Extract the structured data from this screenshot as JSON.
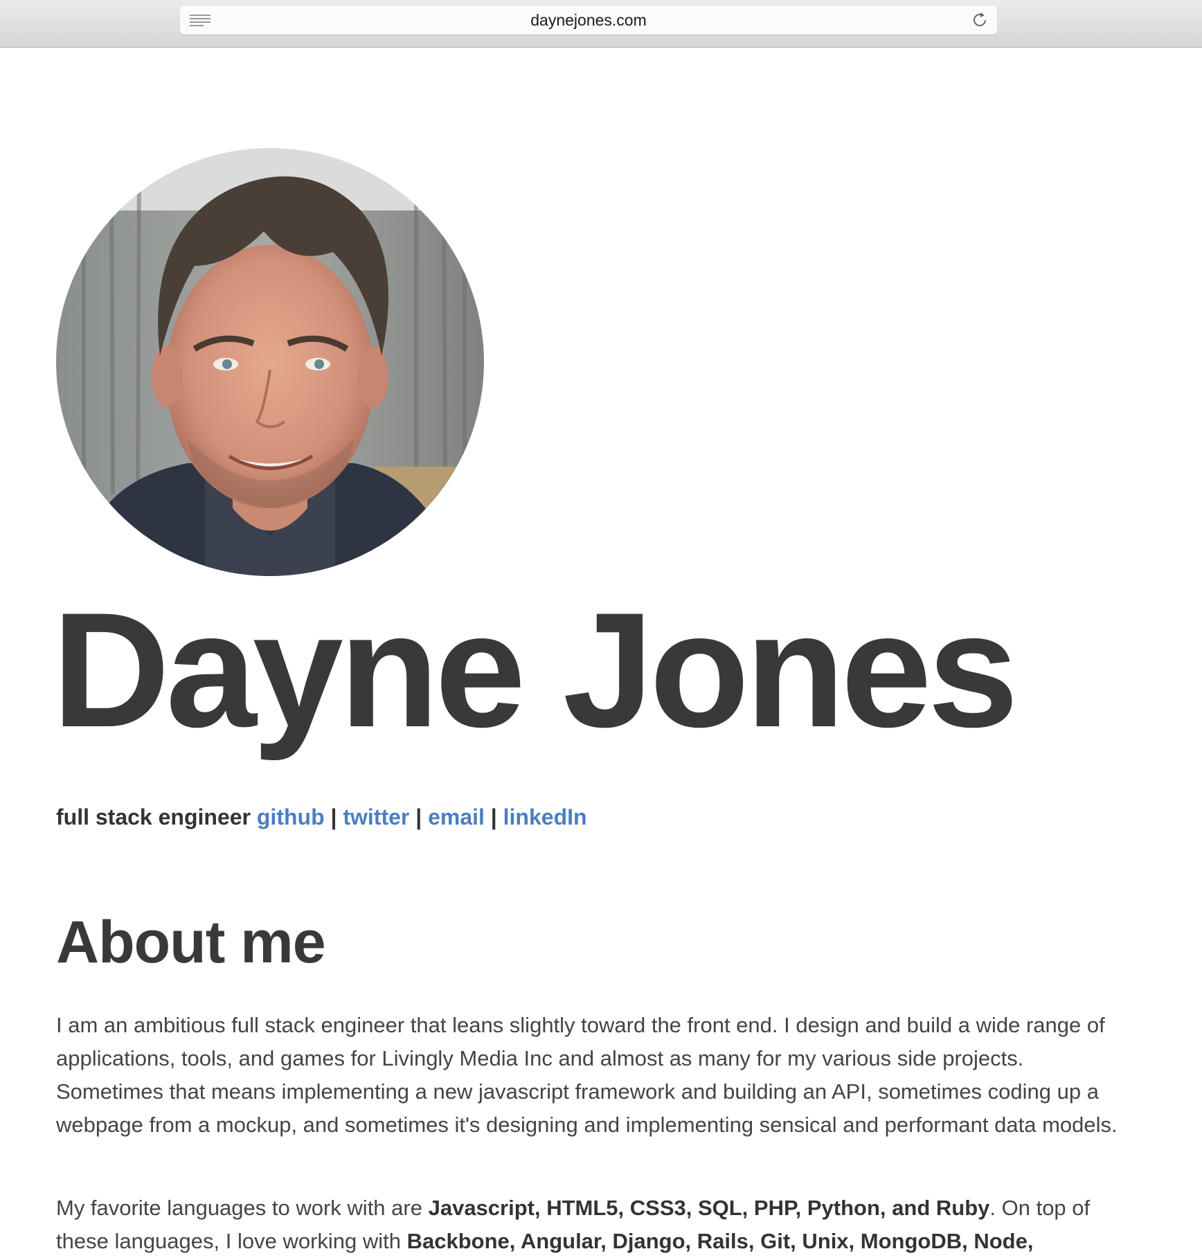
{
  "browser": {
    "url": "daynejones.com"
  },
  "profile": {
    "name": "Dayne Jones",
    "role": "full stack engineer",
    "links": [
      "github",
      "twitter",
      "email",
      "linkedIn"
    ],
    "separator": "|"
  },
  "about": {
    "heading": "About me",
    "paragraph1": "I am an ambitious full stack engineer that leans slightly toward the front end. I design and build a wide range of applications, tools, and games for Livingly Media Inc and almost as many for my various side projects. Sometimes that means implementing a new javascript framework and building an API, sometimes coding up a webpage from a mockup, and sometimes it's designing and implementing sensical and performant data models.",
    "paragraph2_intro": "My favorite languages to work with are ",
    "paragraph2_languages": "Javascript, HTML5, CSS3, SQL, PHP, Python, and Ruby",
    "paragraph2_mid": ". On top of these languages, I love working with ",
    "paragraph2_tools": "Backbone, Angular, Django, Rails, Git, Unix, MongoDB, Node,"
  },
  "colors": {
    "link": "#4a7fc1",
    "text": "#3a3a3a"
  }
}
